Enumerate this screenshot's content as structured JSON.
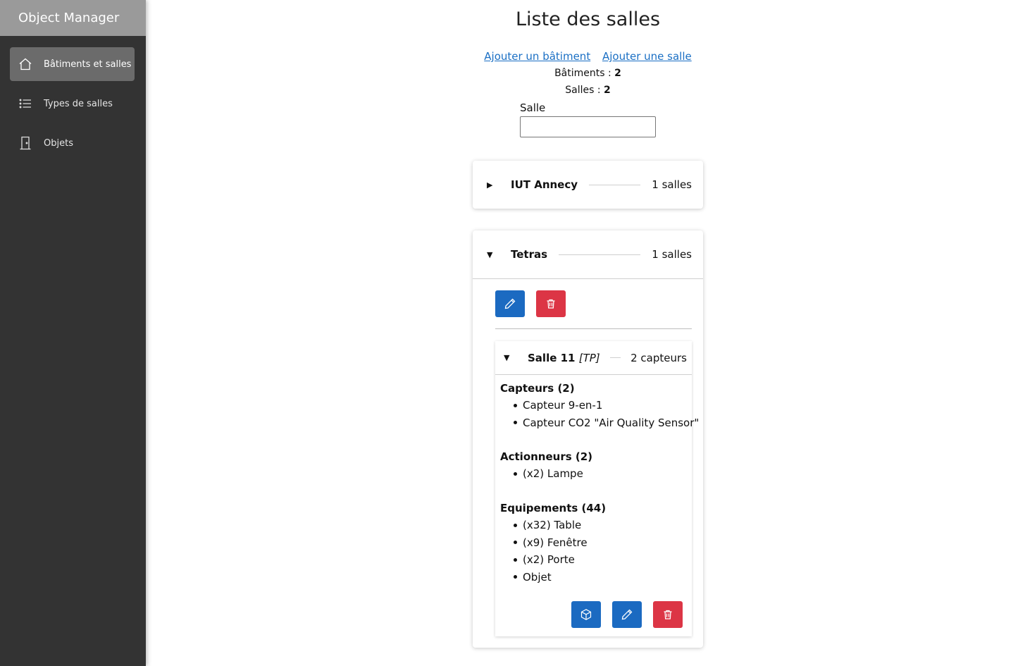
{
  "app": {
    "title": "Object Manager"
  },
  "sidebar": {
    "items": [
      {
        "label": "Bâtiments et salles",
        "icon": "home-icon",
        "active": true
      },
      {
        "label": "Types de salles",
        "icon": "list-icon",
        "active": false
      },
      {
        "label": "Objets",
        "icon": "door-icon",
        "active": false
      }
    ]
  },
  "main": {
    "title": "Liste des salles",
    "links": {
      "add_building": "Ajouter un bâtiment",
      "add_room": "Ajouter une salle"
    },
    "stats": {
      "buildings_label": "Bâtiments :",
      "buildings_value": "2",
      "rooms_label": "Salles :",
      "rooms_value": "2"
    },
    "filter": {
      "label": "Salle",
      "value": ""
    },
    "buildings": [
      {
        "name": "IUT Annecy",
        "count": "1 salles",
        "expanded": false
      },
      {
        "name": "Tetras",
        "count": "1 salles",
        "expanded": true,
        "room": {
          "name": "Salle 11",
          "type": "[TP]",
          "count": "2 capteurs",
          "sensors_title": "Capteurs (2)",
          "sensors": [
            "Capteur 9-en-1",
            "Capteur CO2 \"Air Quality Sensor\""
          ],
          "actuators_title": "Actionneurs (2)",
          "actuators": [
            "(x2) Lampe"
          ],
          "equipment_title": "Equipements (44)",
          "equipment": [
            "(x32) Table",
            "(x9) Fenêtre",
            "(x2) Porte",
            "Objet"
          ]
        }
      }
    ]
  },
  "colors": {
    "primary": "#1b6ac1",
    "danger": "#dc3545",
    "sidebar": "#333333",
    "sidebar_header": "#9a9a9a"
  }
}
